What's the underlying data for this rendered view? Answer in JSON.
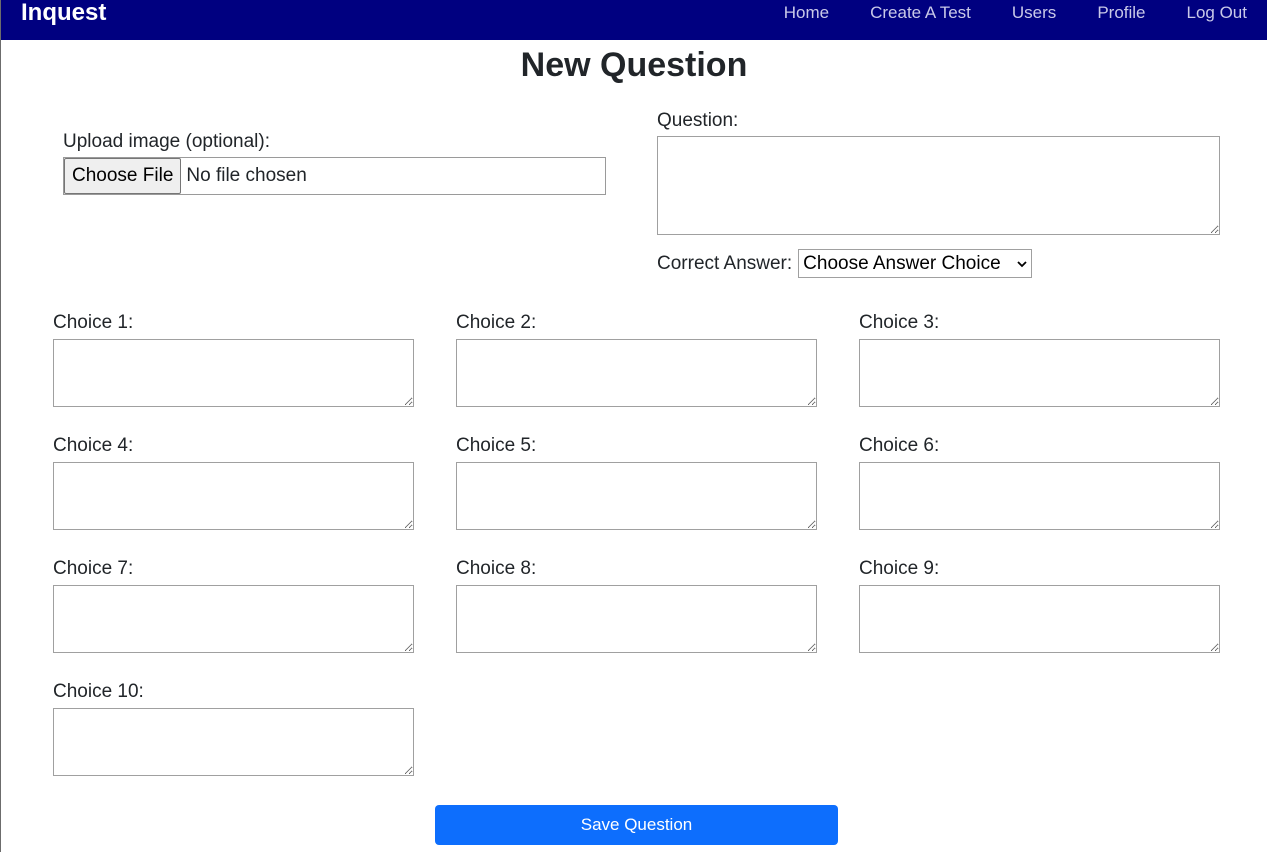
{
  "nav": {
    "brand": "Inquest",
    "links": [
      "Home",
      "Create A Test",
      "Users",
      "Profile",
      "Log Out"
    ]
  },
  "page": {
    "title": "New Question"
  },
  "upload": {
    "label": "Upload image (optional):",
    "button_label": "Choose File",
    "status": "No file chosen"
  },
  "question": {
    "label": "Question:",
    "value": ""
  },
  "correct_answer": {
    "label": "Correct Answer:",
    "selected": "Choose Answer Choice"
  },
  "choices": [
    {
      "label": "Choice 1:",
      "value": ""
    },
    {
      "label": "Choice 2:",
      "value": ""
    },
    {
      "label": "Choice 3:",
      "value": ""
    },
    {
      "label": "Choice 4:",
      "value": ""
    },
    {
      "label": "Choice 5:",
      "value": ""
    },
    {
      "label": "Choice 6:",
      "value": ""
    },
    {
      "label": "Choice 7:",
      "value": ""
    },
    {
      "label": "Choice 8:",
      "value": ""
    },
    {
      "label": "Choice 9:",
      "value": ""
    },
    {
      "label": "Choice 10:",
      "value": ""
    }
  ],
  "save_button": "Save Question",
  "colors": {
    "navbar": "#000080",
    "primary_button": "#0d6efd"
  }
}
